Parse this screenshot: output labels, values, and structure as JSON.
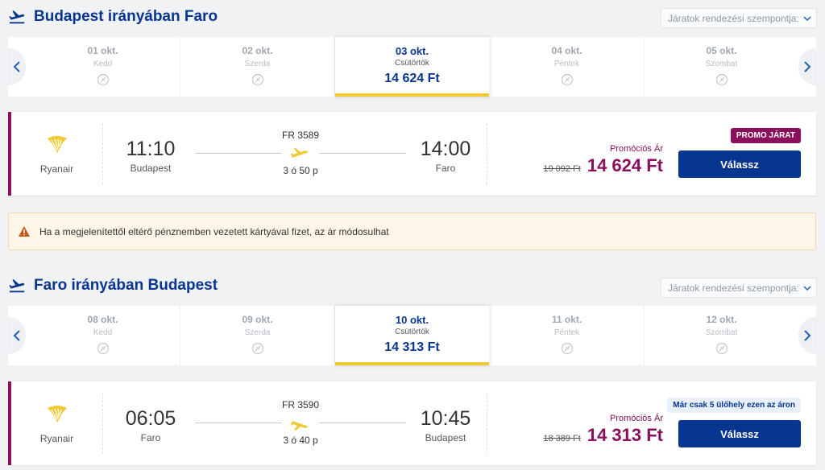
{
  "sort_placeholder": "Járatok rendezési szempontja:",
  "outbound": {
    "title": "Budapest irányában Faro",
    "dates": [
      {
        "date": "01 okt.",
        "day": "Kedd",
        "price": null,
        "active": false
      },
      {
        "date": "02 okt.",
        "day": "Szerda",
        "price": null,
        "active": false
      },
      {
        "date": "03 okt.",
        "day": "Csütörtök",
        "price": "14 624 Ft",
        "active": true
      },
      {
        "date": "04 okt.",
        "day": "Péntek",
        "price": null,
        "active": false
      },
      {
        "date": "05 okt.",
        "day": "Szombat",
        "price": null,
        "active": false
      }
    ],
    "flight": {
      "airline": "Ryanair",
      "dep_time": "11:10",
      "dep_city": "Budapest",
      "flight_no": "FR 3589",
      "duration": "3 ó 50 p",
      "arr_time": "14:00",
      "arr_city": "Faro",
      "badge": "PROMO JÁRAT",
      "price_label": "Promóciós Ár",
      "old_price": "19 092 Ft",
      "price": "14 624 Ft",
      "button": "Válassz"
    }
  },
  "warning": "Ha a megjelenítettől eltérő pénznemben vezetett kártyával fizet, az ár módosulhat",
  "inbound": {
    "title": "Faro irányában Budapest",
    "dates": [
      {
        "date": "08 okt.",
        "day": "Kedd",
        "price": null,
        "active": false
      },
      {
        "date": "09 okt.",
        "day": "Szerda",
        "price": null,
        "active": false
      },
      {
        "date": "10 okt.",
        "day": "Csütörtök",
        "price": "14 313 Ft",
        "active": true
      },
      {
        "date": "11 okt.",
        "day": "Péntek",
        "price": null,
        "active": false
      },
      {
        "date": "12 okt.",
        "day": "Szombat",
        "price": null,
        "active": false
      }
    ],
    "flight": {
      "airline": "Ryanair",
      "dep_time": "06:05",
      "dep_city": "Faro",
      "flight_no": "FR 3590",
      "duration": "3 ó 40 p",
      "arr_time": "10:45",
      "arr_city": "Budapest",
      "badge": "Már csak 5 ülőhely ezen az áron",
      "price_label": "Promóciós Ár",
      "old_price": "18 389 Ft",
      "price": "14 313 Ft",
      "button": "Válassz"
    }
  },
  "colors": {
    "brand_blue": "#073590",
    "promo_purple": "#8a0f5c",
    "accent_yellow": "#f1c933"
  },
  "icons": {
    "flight_header": "plane-departure-icon",
    "no_flight": "no-flight-icon",
    "airline_logo": "ryanair-harp-logo"
  }
}
